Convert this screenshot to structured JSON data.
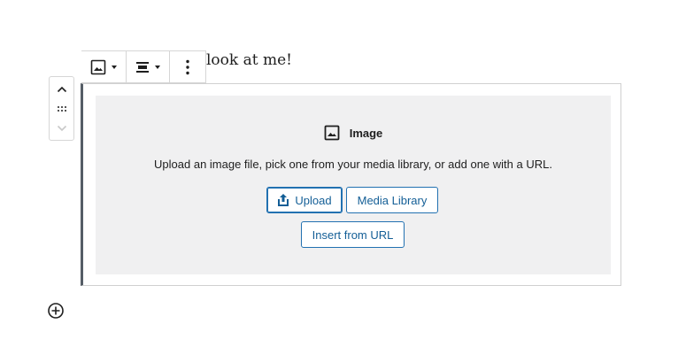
{
  "paragraph": {
    "text": "look at me!"
  },
  "block_toolbar": {
    "block_type_icon": "image-icon",
    "align_icon": "align-center-icon",
    "more_icon": "more-vertical-icon"
  },
  "mover": {
    "up_icon": "chevron-up-icon",
    "drag_icon": "drag-handle-icon",
    "down_icon": "chevron-down-icon"
  },
  "image_block": {
    "label": "Image",
    "instructions": "Upload an image file, pick one from your media library, or add one with a URL.",
    "upload_label": "Upload",
    "media_library_label": "Media Library",
    "insert_url_label": "Insert from URL"
  },
  "inserter": {
    "icon": "plus-circle-icon"
  },
  "colors": {
    "accent": "#2271b1",
    "accent_text": "#135e96",
    "placeholder_bg": "#f0f0f1",
    "block_border_left": "#555d66"
  }
}
